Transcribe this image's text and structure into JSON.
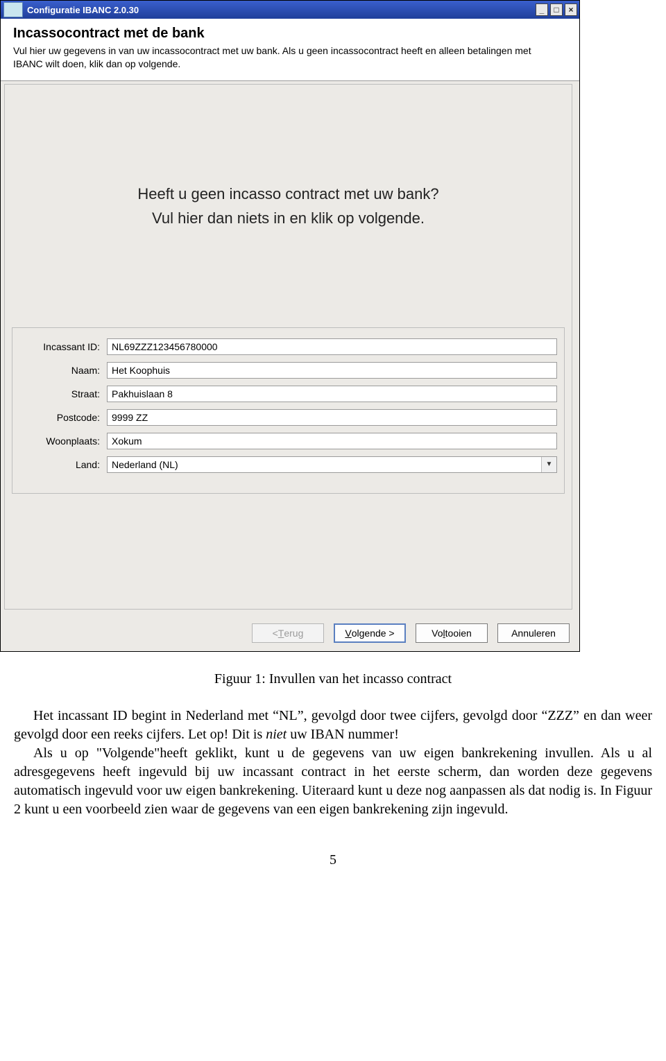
{
  "window": {
    "title": "Configuratie IBANC 2.0.30",
    "controls": {
      "min": "_",
      "max": "□",
      "close": "×"
    }
  },
  "header": {
    "title": "Incassocontract met de bank",
    "subtitle": "Vul hier uw gegevens in van uw incassocontract met uw bank. Als u geen incassocontract heeft en alleen betalingen met IBANC wilt doen, klik dan op volgende."
  },
  "hint": {
    "line1": "Heeft u geen incasso contract met uw bank?",
    "line2": "Vul hier dan niets in en klik op volgende."
  },
  "form": {
    "incassant_id": {
      "label": "Incassant ID:",
      "value": "NL69ZZZ123456780000"
    },
    "naam": {
      "label": "Naam:",
      "value": "Het Koophuis"
    },
    "straat": {
      "label": "Straat:",
      "value": "Pakhuislaan 8"
    },
    "postcode": {
      "label": "Postcode:",
      "value": "9999 ZZ"
    },
    "woonplaats": {
      "label": "Woonplaats:",
      "value": "Xokum"
    },
    "land": {
      "label": "Land:",
      "value": "Nederland (NL)"
    }
  },
  "buttons": {
    "back_lt": "< ",
    "back_u": "T",
    "back_rest": "erug",
    "next_pre": "",
    "next_u": "V",
    "next_rest": "olgende >",
    "finish_pre": "Vo",
    "finish_u": "l",
    "finish_rest": "tooien",
    "cancel": "Annuleren"
  },
  "doc": {
    "caption": "Figuur 1: Invullen van het incasso contract",
    "para1_a": "Het incassant ID begint in Nederland met “NL”, gevolgd door twee cijfers, gevolgd door “ZZZ” en dan weer gevolgd door een reeks cijfers. Let op! Dit is ",
    "para1_em": "niet",
    "para1_b": " uw IBAN nummer!",
    "para2": "Als u op \"Volgende\"heeft geklikt, kunt u de gegevens van uw eigen bankrekening invullen. Als u al adresgegevens heeft ingevuld bij uw incassant contract in het eerste scherm, dan worden deze gegevens automatisch ingevuld voor uw eigen bankrekening. Uiteraard kunt u deze nog aanpassen als dat nodig is. In Figuur 2 kunt u een voorbeeld zien waar de gegevens van een eigen bankrekening zijn ingevuld.",
    "pagenum": "5"
  }
}
